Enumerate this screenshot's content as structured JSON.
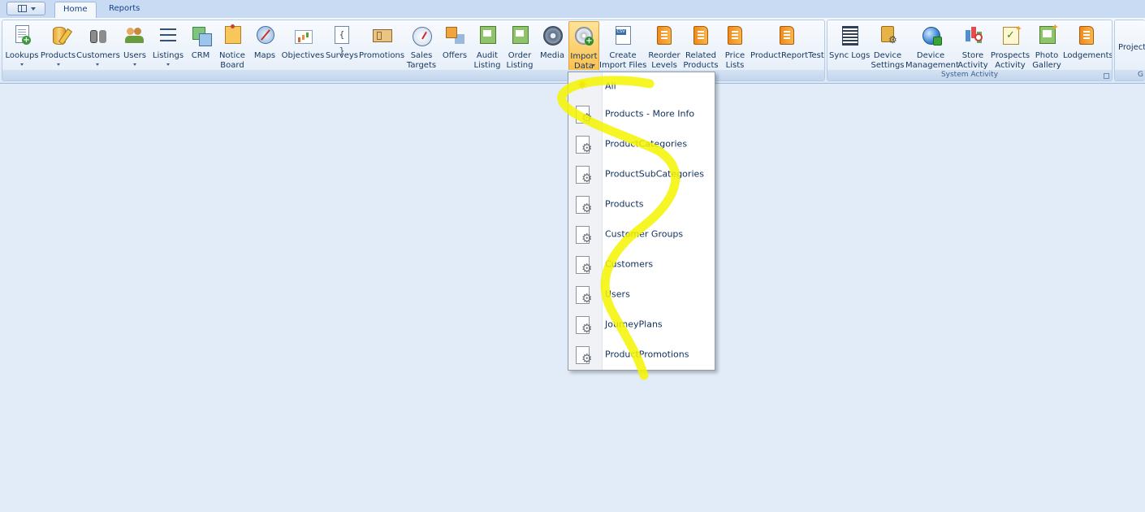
{
  "tabs": [
    {
      "label": "Home",
      "active": true
    },
    {
      "label": "Reports",
      "active": false
    }
  ],
  "ribbon": {
    "buttons": [
      {
        "line1": "Lookups",
        "line2": "",
        "dropdown": true,
        "icon": "lookups-icon"
      },
      {
        "line1": "Products",
        "line2": "",
        "dropdown": true,
        "icon": "products-icon"
      },
      {
        "line1": "Customers",
        "line2": "",
        "dropdown": true,
        "icon": "customers-icon"
      },
      {
        "line1": "Users",
        "line2": "",
        "dropdown": true,
        "icon": "users-icon"
      },
      {
        "line1": "Listings",
        "line2": "",
        "dropdown": true,
        "icon": "listings-icon"
      },
      {
        "line1": "CRM",
        "line2": "",
        "dropdown": false,
        "icon": "crm-icon"
      },
      {
        "line1": "Notice",
        "line2": "Board",
        "dropdown": false,
        "icon": "notice-board-icon"
      },
      {
        "line1": "Maps",
        "line2": "",
        "dropdown": false,
        "icon": "maps-icon"
      },
      {
        "line1": "Objectives",
        "line2": "",
        "dropdown": false,
        "icon": "objectives-icon"
      },
      {
        "line1": "Surveys",
        "line2": "",
        "dropdown": false,
        "icon": "surveys-icon"
      },
      {
        "line1": "Promotions",
        "line2": "",
        "dropdown": false,
        "icon": "promotions-icon"
      },
      {
        "line1": "Sales",
        "line2": "Targets",
        "dropdown": false,
        "icon": "sales-targets-icon"
      },
      {
        "line1": "Offers",
        "line2": "",
        "dropdown": false,
        "icon": "offers-icon"
      },
      {
        "line1": "Audit",
        "line2": "Listing",
        "dropdown": false,
        "icon": "audit-listing-icon"
      },
      {
        "line1": "Order",
        "line2": "Listing",
        "dropdown": false,
        "icon": "order-listing-icon"
      },
      {
        "line1": "Media",
        "line2": "",
        "dropdown": false,
        "icon": "media-icon"
      },
      {
        "line1": "Import",
        "line2": "Data",
        "dropdown": true,
        "icon": "import-data-icon",
        "active": true
      },
      {
        "line1": "Create",
        "line2": "Import Files",
        "dropdown": false,
        "icon": "create-import-files-icon"
      },
      {
        "line1": "Reorder",
        "line2": "Levels",
        "dropdown": false,
        "icon": "reorder-levels-icon"
      },
      {
        "line1": "Related",
        "line2": "Products",
        "dropdown": false,
        "icon": "related-products-icon"
      },
      {
        "line1": "Price",
        "line2": "Lists",
        "dropdown": false,
        "icon": "price-lists-icon"
      },
      {
        "line1": "ProductReportTest",
        "line2": "",
        "dropdown": false,
        "icon": "product-report-test-icon"
      }
    ],
    "system_group_label": "System Activity",
    "system_buttons": [
      {
        "line1": "Sync Logs",
        "line2": "",
        "icon": "sync-logs-icon"
      },
      {
        "line1": "Device",
        "line2": "Settings",
        "icon": "device-settings-icon"
      },
      {
        "line1": "Device",
        "line2": "Management",
        "icon": "device-management-icon"
      },
      {
        "line1": "Store",
        "line2": "Activity",
        "icon": "store-activity-icon"
      },
      {
        "line1": "Prospects",
        "line2": "Activity",
        "icon": "prospects-activity-icon"
      },
      {
        "line1": "Photo",
        "line2": "Gallery",
        "icon": "photo-gallery-icon"
      },
      {
        "line1": "Lodgements",
        "line2": "",
        "icon": "lodgements-icon"
      }
    ],
    "project_label": "Project",
    "partial_group_label": "G"
  },
  "import_menu": {
    "items": [
      {
        "label": "All",
        "icon": "burst-icon"
      },
      {
        "label": "Products - More Info",
        "icon": "gear-document-icon"
      },
      {
        "label": "ProductCategories",
        "icon": "gear-document-icon"
      },
      {
        "label": "ProductSubCategories",
        "icon": "gear-document-icon"
      },
      {
        "label": "Products",
        "icon": "gear-document-icon"
      },
      {
        "label": "Customer Groups",
        "icon": "gear-document-icon"
      },
      {
        "label": "Customers",
        "icon": "gear-document-icon"
      },
      {
        "label": "Users",
        "icon": "gear-document-icon"
      },
      {
        "label": "JourneyPlans",
        "icon": "gear-document-icon"
      },
      {
        "label": "ProductPromotions",
        "icon": "gear-document-icon"
      }
    ]
  },
  "colors": {
    "background": "#e2ecf8",
    "ribbon": "#dfe9f6",
    "active_button": "#fbc04d",
    "highlighter": "#f5f500"
  }
}
